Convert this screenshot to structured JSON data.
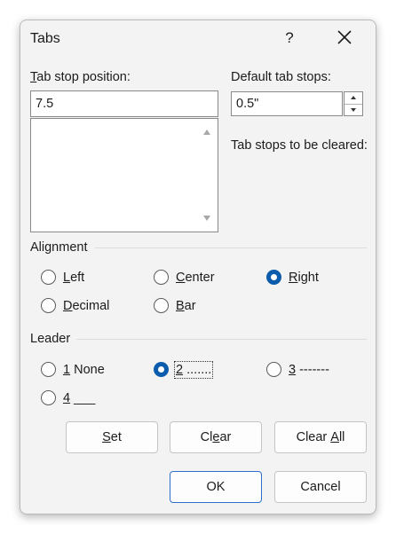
{
  "dialog": {
    "title": "Tabs",
    "help_label": "?"
  },
  "tab_stop": {
    "label_first": "T",
    "label_rest": "ab stop position:",
    "value": "7.5"
  },
  "default_tabs": {
    "label": "Default tab stops:",
    "value": "0.5\""
  },
  "cleared": {
    "label": "Tab stops to be cleared:"
  },
  "alignment": {
    "label": "Alignment",
    "options": [
      {
        "key": "L",
        "rest": "eft",
        "checked": false
      },
      {
        "key": "C",
        "rest": "enter",
        "checked": false
      },
      {
        "key": "R",
        "rest": "ight",
        "checked": true
      },
      {
        "key": "D",
        "rest": "ecimal",
        "checked": false
      },
      {
        "key": "B",
        "rest": "ar",
        "checked": false
      }
    ]
  },
  "leader": {
    "label": "Leader",
    "options": [
      {
        "key": "1",
        "rest": " None",
        "checked": false
      },
      {
        "key": "2",
        "rest": " .......",
        "checked": true
      },
      {
        "key": "3",
        "rest": " -------",
        "checked": false
      },
      {
        "key": "4",
        "rest": " ___",
        "checked": false
      }
    ]
  },
  "buttons": {
    "set_key": "S",
    "set_rest": "et",
    "clear_pre": "Cl",
    "clear_key": "e",
    "clear_rest": "ar",
    "clear_all_pre": "Clear ",
    "clear_all_key": "A",
    "clear_all_rest": "ll",
    "ok": "OK",
    "cancel": "Cancel"
  }
}
